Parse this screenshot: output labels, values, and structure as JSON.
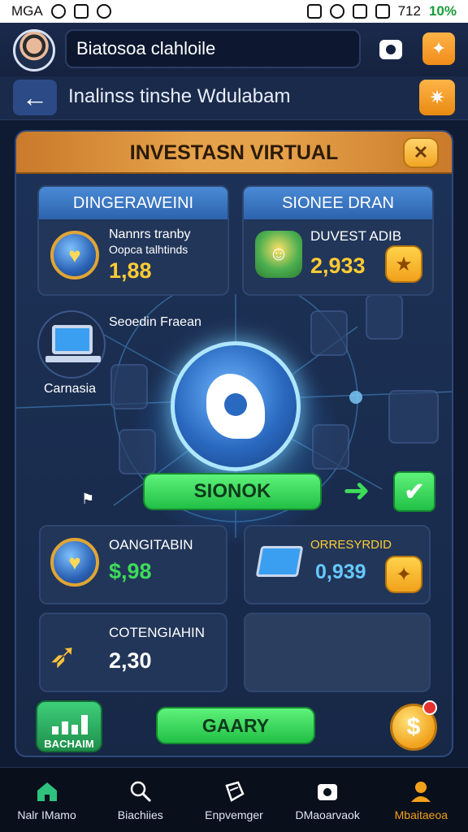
{
  "status_bar": {
    "left_text": "MGA",
    "right_text": "712",
    "battery": "10%"
  },
  "profile": {
    "search_value": "Biatosoa clahloile"
  },
  "nav": {
    "back_symbol": "←",
    "title": "Inalinss tinshe Wdulabam"
  },
  "panel": {
    "title": "INVESTASN VIRTUAL",
    "close_symbol": "✕",
    "card1": {
      "header": "DINGERAWEINI",
      "label_line1": "Nannrs tranby",
      "label_line2": "Oopca talhtinds",
      "value": "1,88"
    },
    "card2": {
      "header": "SIONEE DRAN",
      "label": "DUVEST ADIB",
      "value": "2,933"
    },
    "side_title": "Seoedin Fraean",
    "side_label": "Carnasia",
    "primary_button": "SIONOK",
    "arrow_symbol": "➜",
    "check_symbol": "✔",
    "small_icon_symbol": "⚑",
    "card3": {
      "label": "OANGITABIN",
      "value": "$,98"
    },
    "card4": {
      "label": "ORRESYRDID",
      "value": "0,939"
    },
    "card5": {
      "label": "COTENGIAHIN",
      "value": "2,30"
    },
    "chart_button_label": "BACHAIM",
    "secondary_button": "GAARY",
    "dollar_symbol": "$"
  },
  "bottom_nav": [
    {
      "label": "Nalr IMamo",
      "icon": "home-icon"
    },
    {
      "label": "Biachiies",
      "icon": "search-icon"
    },
    {
      "label": "Enpvemger",
      "icon": "tag-icon"
    },
    {
      "label": "DMaoarvaok",
      "icon": "camera-icon"
    },
    {
      "label": "Mbaitaeoa",
      "icon": "profile-icon"
    }
  ],
  "colors": {
    "accent_orange": "#f2a11b",
    "accent_green": "#3ddc5a",
    "panel_bg": "#1d3258"
  }
}
